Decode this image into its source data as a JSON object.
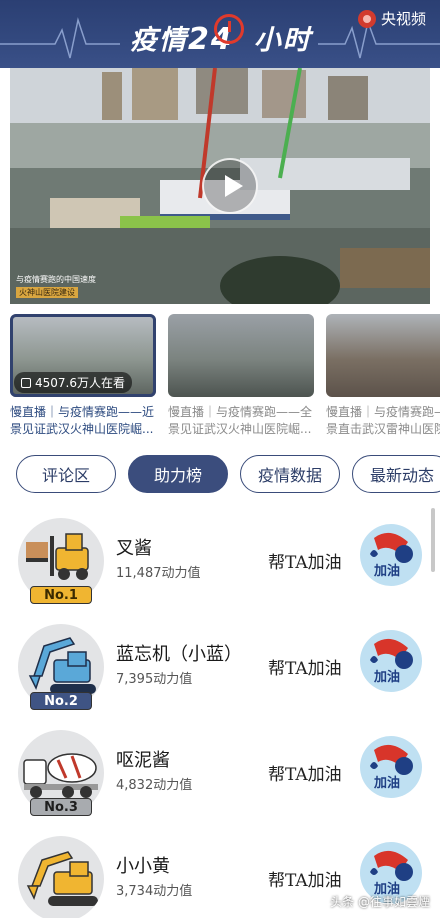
{
  "header": {
    "title_part1": "疫情",
    "title_num": "24",
    "title_part2": "小时",
    "brand": "央视频",
    "colors": {
      "header_bg": "#33497f",
      "accent_red": "#e03a2c"
    }
  },
  "video": {
    "caption_line1": "与疫情赛跑的中国速度",
    "caption_line2": "火神山医院建设",
    "icon": "play-icon"
  },
  "thumbnails": [
    {
      "viewers": "4507.6万人在看",
      "caption": "慢直播｜与疫情赛跑——近景见证武汉火神山医院崛...",
      "active": true
    },
    {
      "caption": "慢直播｜与疫情赛跑——全景见证武汉火神山医院崛...",
      "active": false
    },
    {
      "caption": "慢直播｜与疫情赛跑——近景直击武汉雷神山医院...",
      "active": false
    }
  ],
  "tabs": [
    {
      "label": "评论区",
      "active": false
    },
    {
      "label": "助力榜",
      "active": true
    },
    {
      "label": "疫情数据",
      "active": false
    },
    {
      "label": "最新动态",
      "active": false
    }
  ],
  "leaderboard": [
    {
      "rank": "No.1",
      "name": "叉酱",
      "score": "11,487动力值",
      "cheer": "帮TA加油",
      "button": "加油",
      "icon": "forklift-icon"
    },
    {
      "rank": "No.2",
      "name": "蓝忘机（小蓝）",
      "score": "7,395动力值",
      "cheer": "帮TA加油",
      "button": "加油",
      "icon": "excavator-icon"
    },
    {
      "rank": "No.3",
      "name": "呕泥酱",
      "score": "4,832动力值",
      "cheer": "帮TA加油",
      "button": "加油",
      "icon": "mixer-truck-icon"
    },
    {
      "rank": "",
      "name": "小小黄",
      "score": "3,734动力值",
      "cheer": "帮TA加油",
      "button": "加油",
      "icon": "yellow-excavator-icon"
    }
  ],
  "watermark": "头条 @往事如雲煙"
}
